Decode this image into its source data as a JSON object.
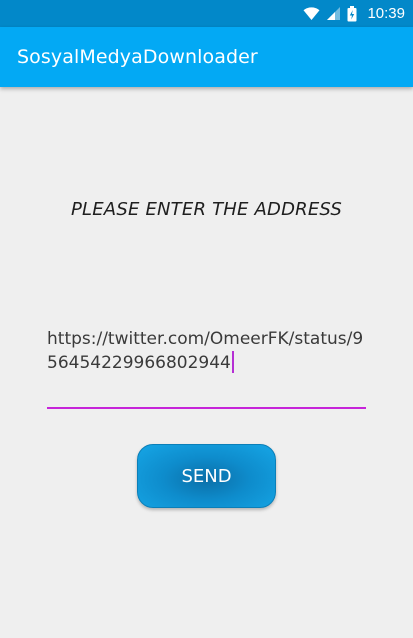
{
  "status_bar": {
    "time": "10:39",
    "icons": [
      "wifi-icon",
      "signal-icon",
      "battery-icon"
    ]
  },
  "app_bar": {
    "title": "SosyalMedyaDownloader",
    "color": "#03a9f4"
  },
  "main": {
    "prompt": "PLEASE ENTER THE ADDRESS",
    "url_input": {
      "value": "https://twitter.com/OmeerFK/status/956454229966802944"
    },
    "send_button_label": "SEND"
  },
  "colors": {
    "status_bar": "#0288c9",
    "accent": "#c624d9",
    "button": "#0e8ccc",
    "background": "#efefef"
  }
}
